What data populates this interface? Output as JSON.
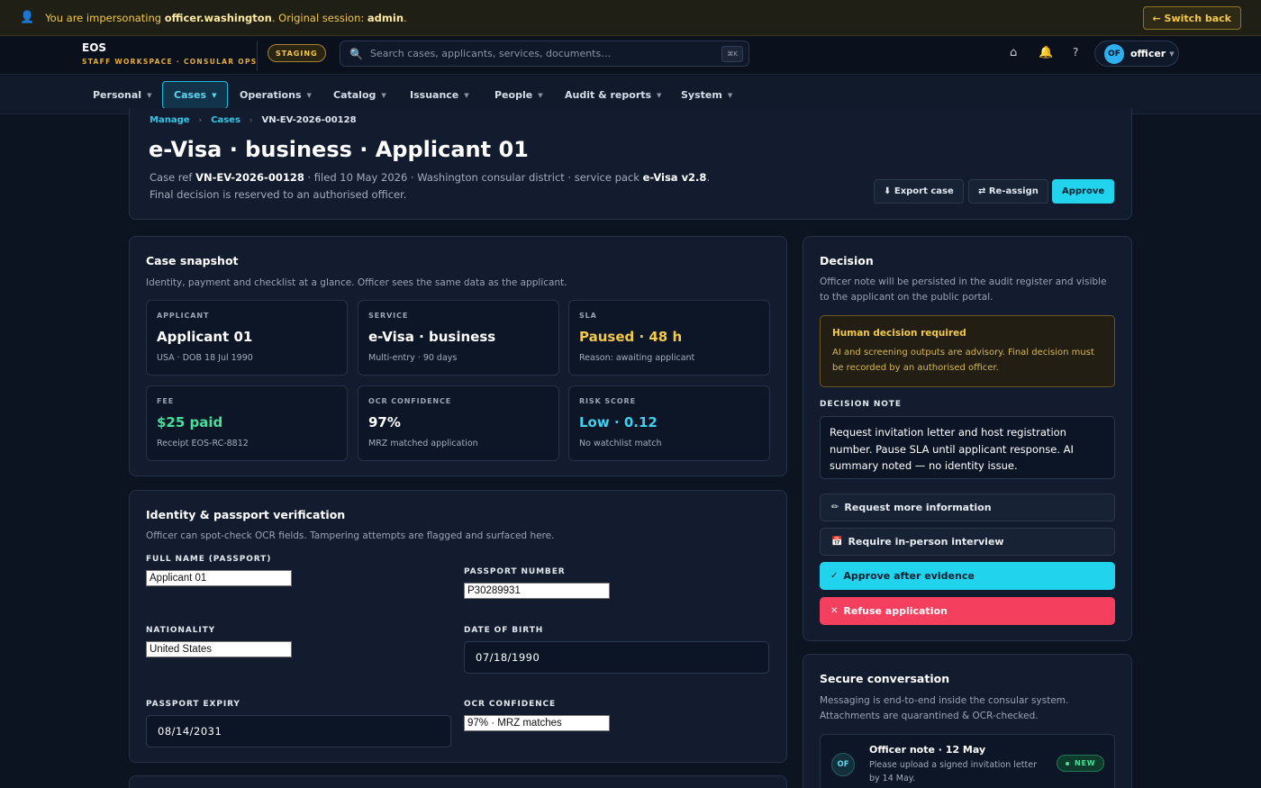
{
  "banner": {
    "prefix": "You are impersonating ",
    "user": "officer.washington",
    "middle": ". Original session: ",
    "original": "admin",
    "suffix": ".",
    "switch_label": "← Switch back"
  },
  "brand": {
    "name": "EOS",
    "subtitle": "STAFF WORKSPACE · CONSULAR OPS"
  },
  "env_badge": "STAGING",
  "search": {
    "placeholder": "Search cases, applicants, services, documents…",
    "shortcut": "⌘K"
  },
  "header_icons": {
    "home": "⌂",
    "notifications": "🔔",
    "help": "?"
  },
  "user": {
    "initials": "OF",
    "name": "officer"
  },
  "nav": [
    {
      "label": "Personal",
      "active": false
    },
    {
      "label": "Cases",
      "active": true
    },
    {
      "label": "Operations",
      "active": false
    },
    {
      "label": "Catalog",
      "active": false
    },
    {
      "label": "Issuance",
      "active": false
    },
    {
      "label": "People",
      "active": false
    },
    {
      "label": "Audit & reports",
      "active": false
    },
    {
      "label": "System",
      "active": false
    }
  ],
  "breadcrumb": {
    "manage": "Manage",
    "cases": "Cases",
    "current": "VN-EV-2026-00128",
    "sep": "›"
  },
  "page": {
    "title": "e-Visa · business · Applicant 01",
    "sub_prefix": "Case ref ",
    "case_ref": "VN-EV-2026-00128",
    "sub_middle": " · filed 10 May 2026 · Washington consular district · service pack ",
    "pack": "e-Visa v2.8",
    "sub_suffix": ". Final decision is reserved to an authorised officer.",
    "export_label": "⬇ Export case",
    "reassign_label": "⇄ Re-assign",
    "approve_label": "Approve"
  },
  "snapshot": {
    "title": "Case snapshot",
    "description": "Identity, payment and checklist at a glance. Officer sees the same data as the applicant.",
    "stats": [
      {
        "label": "APPLICANT",
        "value": "Applicant 01",
        "note": "USA · DOB 18 Jul 1990",
        "color": "#ffffff"
      },
      {
        "label": "SERVICE",
        "value": "e-Visa · business",
        "note": "Multi-entry · 90 days",
        "color": "#ffffff"
      },
      {
        "label": "SLA",
        "value": "Paused · 48 h",
        "note": "Reason: awaiting applicant",
        "color": "#f2c94c"
      },
      {
        "label": "FEE",
        "value": "$25 paid",
        "note": "Receipt EOS-RC-8812",
        "color": "#47e09a"
      },
      {
        "label": "OCR CONFIDENCE",
        "value": "97%",
        "note": "MRZ matched application",
        "color": "#ffffff"
      },
      {
        "label": "RISK SCORE",
        "value": "Low · 0.12",
        "note": "No watchlist match",
        "color": "#3fd0ef"
      }
    ]
  },
  "identity": {
    "title": "Identity & passport verification",
    "description": "Officer can spot-check OCR fields. Tampering attempts are flagged and surfaced here.",
    "full_name_label": "FULL NAME (PASSPORT)",
    "full_name_value": "Applicant 01",
    "passport_label": "PASSPORT NUMBER",
    "passport_value": "P30289931",
    "nationality_label": "NATIONALITY",
    "nationality_value": "United States",
    "dob_label": "DATE OF BIRTH",
    "dob_value": "07/18/1990",
    "expiry_label": "PASSPORT EXPIRY",
    "expiry_value": "08/14/2031",
    "ocr_label": "OCR CONFIDENCE",
    "ocr_value": "97% · MRZ matches"
  },
  "decision": {
    "title": "Decision",
    "description": "Officer note will be persisted in the audit register and visible to the applicant on the public portal.",
    "warn_title": "Human decision required",
    "warn_body": "AI and screening outputs are advisory. Final decision must be recorded by an authorised officer.",
    "note_label": "DECISION NOTE",
    "note_value": "Request invitation letter and host registration number. Pause SLA until applicant response. AI summary noted — no identity issue.",
    "actions": {
      "request_info": "Request more information",
      "interview": "Require in-person interview",
      "approve_after": "Approve after evidence",
      "refuse": "Refuse application"
    }
  },
  "conversation": {
    "title": "Secure conversation",
    "description": "Messaging is end-to-end inside the consular system. Attachments are quarantined & OCR-checked.",
    "message": {
      "initials": "OF",
      "title": "Officer note · 12 May",
      "body": "Please upload a signed invitation letter by 14 May.",
      "badge": "NEW"
    }
  }
}
